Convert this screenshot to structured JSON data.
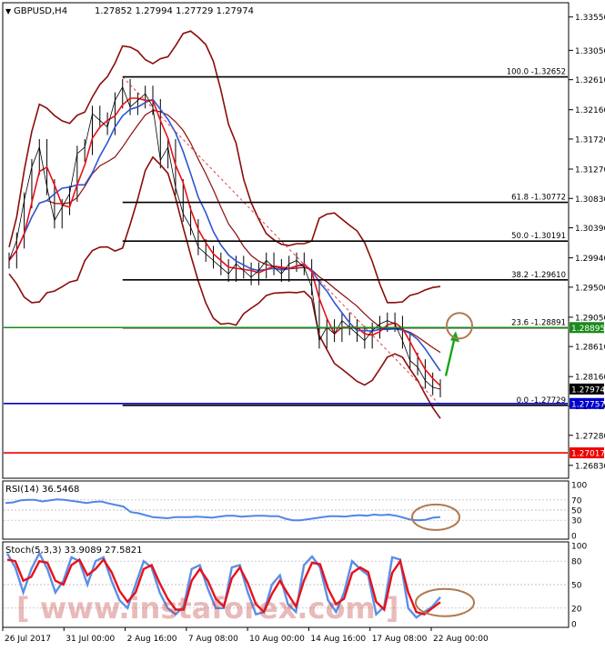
{
  "header": {
    "symbol": "GBPUSD,H4",
    "ohlc": "1.27852 1.27994 1.27729 1.27974"
  },
  "colors": {
    "price_bars": "#000000",
    "ma_fast": "#e8101a",
    "ma_mid": "#2f55d4",
    "bollinger": "#8b0c0c",
    "fib_lines": "#000000",
    "green_line": "#1a8a1a",
    "blue_line": "#0000cc",
    "red_line": "#ee0000",
    "rsi_line": "#4f86e8",
    "stoch_main": "#5b8fe6",
    "stoch_signal": "#e8101a",
    "annotation_circle": "#b07a52",
    "annotation_arrow": "#1aa51a",
    "watermark": "#c03a3a"
  },
  "chart_data": [
    {
      "type": "line",
      "panel": "price",
      "title": "GBPUSD,H4",
      "price_axis_ticks": [
        "1.33550",
        "1.33050",
        "1.32610",
        "1.32160",
        "1.31720",
        "1.31270",
        "1.30830",
        "1.30390",
        "1.29940",
        "1.29500",
        "1.29050",
        "1.28610",
        "1.28160",
        "1.27720",
        "1.27280",
        "1.26830"
      ],
      "ylim": [
        1.2665,
        1.3375
      ],
      "fibonacci_levels": [
        {
          "label": "100.0 -1.32652",
          "value": 1.32652
        },
        {
          "label": "61.8 -1.30772",
          "value": 1.30772
        },
        {
          "label": "50.0 -1.30191",
          "value": 1.30191
        },
        {
          "label": "38.2 -1.29610",
          "value": 1.2961
        },
        {
          "label": "23.6 -1.28891",
          "value": 1.28891
        },
        {
          "label": "0.0 -1.27729",
          "value": 1.27729
        }
      ],
      "horizontal_lines": [
        {
          "name": "green",
          "value": 1.28895,
          "label": "1.28895"
        },
        {
          "name": "current",
          "value": 1.27974,
          "label": "1.27974"
        },
        {
          "name": "blue",
          "value": 1.27757,
          "label": "1.27757"
        },
        {
          "name": "red",
          "value": 1.27017,
          "label": "1.27017"
        }
      ],
      "close_series": [
        1.299,
        1.302,
        1.308,
        1.313,
        1.316,
        1.31,
        1.305,
        1.307,
        1.309,
        1.315,
        1.316,
        1.321,
        1.32,
        1.319,
        1.323,
        1.325,
        1.322,
        1.323,
        1.324,
        1.322,
        1.314,
        1.316,
        1.31,
        1.306,
        1.304,
        1.301,
        1.3,
        1.299,
        1.298,
        1.297,
        1.2985,
        1.2975,
        1.2965,
        1.2975,
        1.299,
        1.298,
        1.297,
        1.2985,
        1.299,
        1.298,
        1.295,
        1.287,
        1.289,
        1.288,
        1.29,
        1.289,
        1.288,
        1.287,
        1.2885,
        1.2895,
        1.29,
        1.2895,
        1.287,
        1.284,
        1.283,
        1.281,
        1.28,
        1.2797
      ],
      "annotations": [
        {
          "type": "arrow",
          "direction": "up",
          "note": "target 1.28895"
        },
        {
          "type": "circle",
          "note": "target zone"
        }
      ]
    },
    {
      "type": "line",
      "panel": "rsi",
      "title": "RSI(14) 36.5468",
      "yticks": [
        100,
        70,
        50,
        30,
        0
      ],
      "ylim": [
        0,
        100
      ],
      "values": [
        64,
        65,
        69,
        70,
        70,
        67,
        69,
        71,
        70,
        68,
        66,
        64,
        66,
        67,
        63,
        60,
        57,
        46,
        44,
        40,
        36,
        35,
        34,
        36,
        36,
        36,
        37,
        36,
        35,
        37,
        39,
        39,
        37,
        38,
        39,
        39,
        38,
        38,
        33,
        30,
        30,
        32,
        34,
        36,
        38,
        38,
        37,
        39,
        40,
        39,
        41,
        40,
        41,
        39,
        35,
        31,
        30,
        31,
        35,
        36.5
      ]
    },
    {
      "type": "line",
      "panel": "stochastic",
      "title": "Stoch(5,3,3) 33.9089 27.5821",
      "yticks": [
        100,
        80,
        50,
        20,
        0
      ],
      "ylim": [
        0,
        100
      ],
      "x_labels": [
        "26 Jul 2017",
        "31 Jul 00:00",
        "2 Aug 16:00",
        "7 Aug 08:00",
        "10 Aug 00:00",
        "14 Aug 16:00",
        "17 Aug 08:00",
        "22 Aug 00:00"
      ],
      "series": [
        {
          "name": "main",
          "values": [
            90,
            72,
            40,
            70,
            90,
            70,
            40,
            55,
            85,
            80,
            50,
            80,
            85,
            55,
            30,
            20,
            50,
            80,
            72,
            40,
            20,
            12,
            22,
            70,
            75,
            45,
            20,
            20,
            72,
            75,
            40,
            12,
            15,
            50,
            62,
            25,
            15,
            75,
            86,
            72,
            30,
            15,
            40,
            80,
            70,
            62,
            12,
            22,
            85,
            82,
            20,
            8,
            15,
            22,
            33.9
          ]
        },
        {
          "name": "signal",
          "values": [
            82,
            80,
            55,
            60,
            80,
            78,
            55,
            50,
            75,
            82,
            62,
            70,
            82,
            66,
            42,
            28,
            40,
            70,
            75,
            52,
            32,
            18,
            18,
            55,
            70,
            55,
            32,
            22,
            58,
            72,
            52,
            25,
            15,
            38,
            55,
            38,
            22,
            55,
            78,
            76,
            45,
            25,
            32,
            65,
            72,
            66,
            28,
            18,
            65,
            80,
            40,
            15,
            12,
            20,
            27.6
          ]
        }
      ]
    }
  ],
  "watermark": "[ www.instaforex.com ]"
}
